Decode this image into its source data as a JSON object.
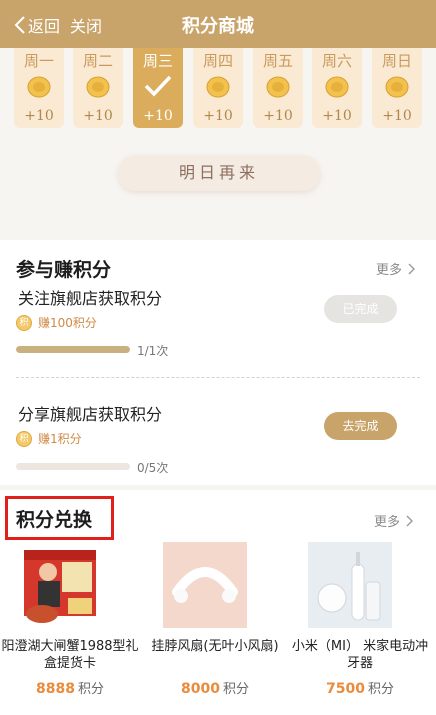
{
  "header": {
    "back_label": "返回",
    "close_label": "关闭",
    "title": "积分商城"
  },
  "checkin": {
    "days": [
      {
        "label": "周一",
        "points": "+10",
        "active": false
      },
      {
        "label": "周二",
        "points": "+10",
        "active": false
      },
      {
        "label": "周三",
        "points": "+10",
        "active": true
      },
      {
        "label": "周四",
        "points": "+10",
        "active": false
      },
      {
        "label": "周五",
        "points": "+10",
        "active": false
      },
      {
        "label": "周六",
        "points": "+10",
        "active": false
      },
      {
        "label": "周日",
        "points": "+10",
        "active": false
      }
    ],
    "button_label": "明日再来"
  },
  "earn": {
    "title": "参与赚积分",
    "more_label": "更多",
    "tasks": [
      {
        "name": "关注旗舰店获取积分",
        "reward": "赚100积分",
        "progress_text": "1/1次",
        "progress_fraction": 1.0,
        "status": "已完成"
      },
      {
        "name": "分享旗舰店获取积分",
        "reward": "赚1积分",
        "progress_text": "0/5次",
        "progress_fraction": 0.0,
        "status": "去完成"
      }
    ]
  },
  "exchange": {
    "title": "积分兑换",
    "more_label": "更多",
    "products": [
      {
        "name": "阳澄湖大闸蟹1988型礼盒提货卡",
        "price": "8888",
        "unit": "积分"
      },
      {
        "name": "挂脖风扇(无叶小风扇)",
        "price": "8000",
        "unit": "积分"
      },
      {
        "name": "小米（MI） 米家电动冲牙器",
        "price": "7500",
        "unit": "积分"
      }
    ]
  },
  "colors": {
    "header": "#c9a46a",
    "accent_gold": "#dcac5d",
    "price_orange": "#ea8b3c",
    "highlight_red": "#e0201b"
  }
}
